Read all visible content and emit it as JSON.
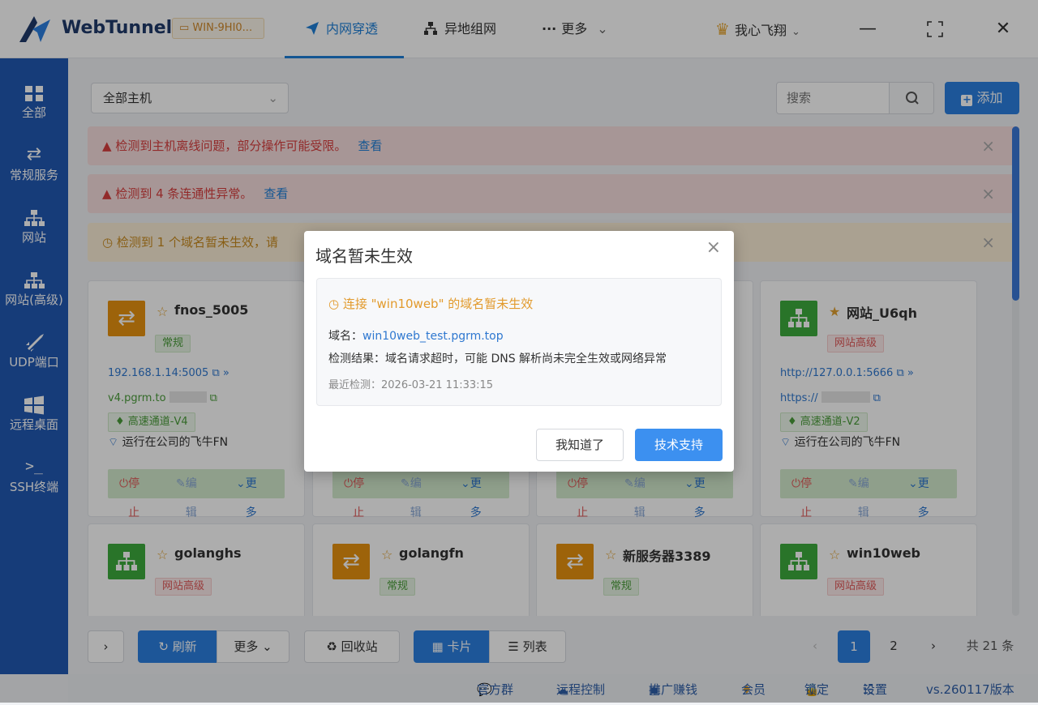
{
  "titlebar": {
    "brand": "WebTunnel",
    "host": "WIN-9HI0...",
    "nav": [
      {
        "label": "内网穿透",
        "icon": "send-icon"
      },
      {
        "label": "异地组网",
        "icon": "network-icon"
      },
      {
        "label": "更多",
        "icon": "ellipsis-icon"
      }
    ],
    "user": "我心飞翔"
  },
  "sidebar": {
    "items": [
      {
        "label": "全部",
        "icon": "grid-icon"
      },
      {
        "label": "常规服务",
        "icon": "swap-icon"
      },
      {
        "label": "网站",
        "icon": "sitemap-icon"
      },
      {
        "label": "网站(高级)",
        "icon": "sitemap-icon"
      },
      {
        "label": "UDP端口",
        "icon": "rocket-icon"
      },
      {
        "label": "远程桌面",
        "icon": "windows-icon"
      },
      {
        "label": "SSH终端",
        "icon": "terminal-icon"
      }
    ]
  },
  "toolbar": {
    "host_filter": "全部主机",
    "search_placeholder": "搜索",
    "add_label": "添加"
  },
  "alerts": [
    {
      "text": "检测到主机离线问题，部分操作可能受限。",
      "link": "查看",
      "type": "red"
    },
    {
      "text": "检测到 4 条连通性异常。",
      "link": "查看",
      "type": "red"
    },
    {
      "text": "检测到 1 个域名暂未生效，请",
      "link": "",
      "type": "yellow"
    }
  ],
  "cards": [
    {
      "name": "fnos_5005",
      "tag": "常规",
      "local": "192.168.1.14:5005",
      "remote": "v4.pgrm.to",
      "channel": "高速通道-V4",
      "note": "运行在公司的飞牛FN",
      "stop": "停止",
      "edit": "编辑",
      "more": "更多"
    },
    {
      "name": "",
      "tag": "",
      "local": "",
      "remote": "",
      "channel": "",
      "note": "",
      "stop": "停止",
      "edit": "编辑",
      "more": "更多"
    },
    {
      "name": "",
      "tag": "",
      "local": "",
      "remote": "",
      "channel": "",
      "note": "",
      "stop": "停止",
      "edit": "编辑",
      "more": "更多"
    },
    {
      "name": "网站_U6qh",
      "tag": "网站高级",
      "local": "http://127.0.0.1:5666",
      "remote": "https://",
      "channel": "高速通道-V2",
      "note": "运行在公司的飞牛FN",
      "stop": "停止",
      "edit": "编辑",
      "more": "更多"
    },
    {
      "name": "golanghs",
      "tag": "网站高级"
    },
    {
      "name": "golangfn",
      "tag": "常规"
    },
    {
      "name": "新服务器3389",
      "tag": "常规"
    },
    {
      "name": "win10web",
      "tag": "网站高级"
    }
  ],
  "bottom": {
    "expand": "›",
    "refresh": "刷新",
    "more": "更多",
    "recycle": "回收站",
    "card_view": "卡片",
    "list_view": "列表",
    "pages": [
      "1",
      "2"
    ],
    "total": "共 21 条"
  },
  "footer": {
    "items": [
      "官方群",
      "远程控制",
      "推广赚钱",
      "会员",
      "锁定",
      "设置"
    ],
    "version": "vs.260117版本"
  },
  "modal": {
    "title": "域名暂未生效",
    "warning": "连接 \"win10web\" 的域名暂未生效",
    "domain_label": "域名：",
    "domain": "win10web_test.pgrm.top",
    "result": "检测结果：域名请求超时，可能 DNS 解析尚未完全生效或网络异常",
    "time": "最近检测：2026-03-21 11:33:15",
    "ok": "我知道了",
    "support": "技术支持"
  },
  "colors": {
    "primary": "#2b7fe0",
    "sidebar": "#2159b3",
    "warning": "#e29a2c",
    "danger": "#d83f3f",
    "success": "#4a9d3a"
  }
}
